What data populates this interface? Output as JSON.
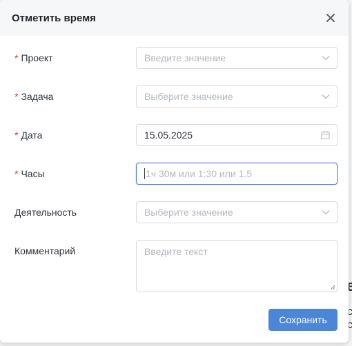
{
  "dialog": {
    "title": "Отметить время",
    "close_icon": "close-icon"
  },
  "form": {
    "required_mark": "*",
    "project": {
      "label": "Проект",
      "placeholder": "Введите значение",
      "icon": "chevron-down-icon"
    },
    "task": {
      "label": "Задача",
      "placeholder": "Выберите значение",
      "icon": "chevron-down-icon"
    },
    "date": {
      "label": "Дата",
      "value": "15.05.2025",
      "icon": "calendar-icon"
    },
    "hours": {
      "label": "Часы",
      "placeholder": "1ч 30м или 1:30 или 1.5"
    },
    "activity": {
      "label": "Деятельность",
      "placeholder": "Выберите значение",
      "icon": "chevron-down-icon"
    },
    "comment": {
      "label": "Комментарий",
      "placeholder": "Введите текст"
    }
  },
  "footer": {
    "save_label": "Сохранить"
  },
  "colors": {
    "accent": "#4c86d6",
    "required": "#d9302c",
    "focus_border": "#4c7ed0"
  }
}
